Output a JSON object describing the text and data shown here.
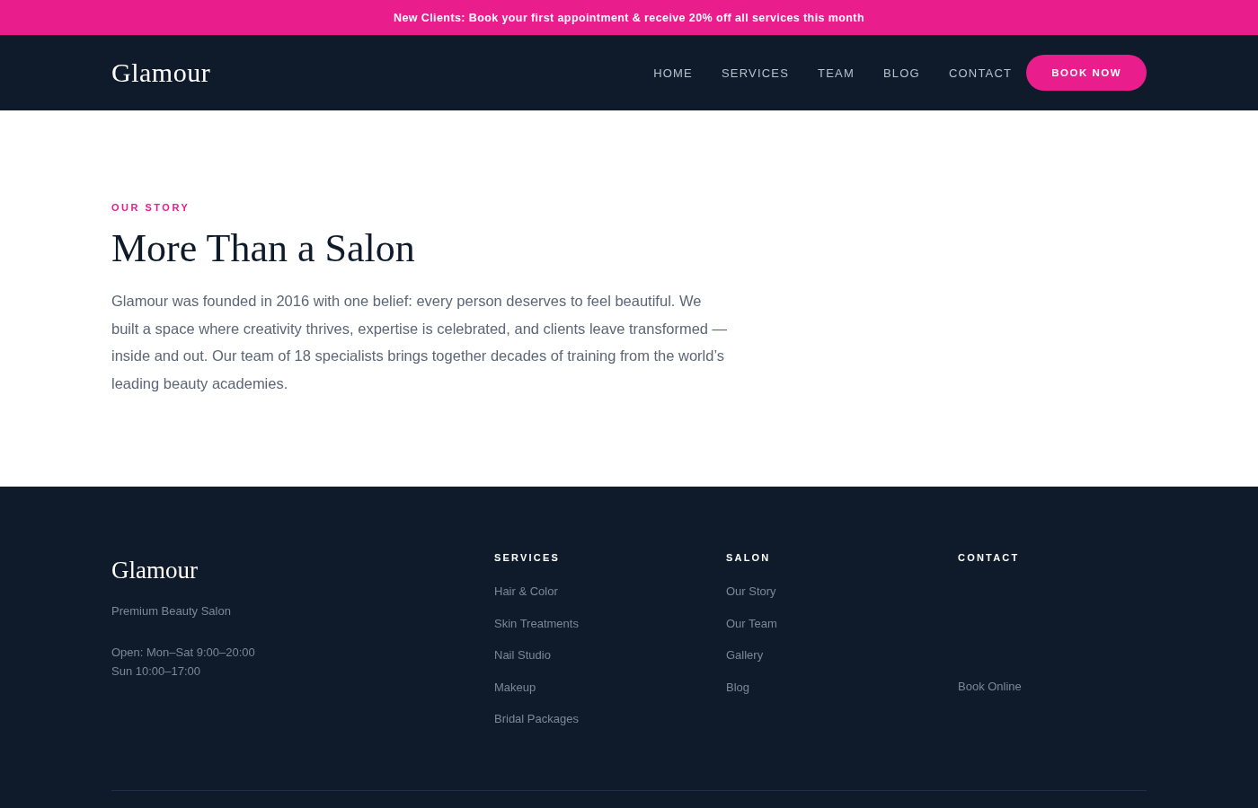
{
  "announcement": "**New Clients:** Book your first appointment & receive 20% off all services this month",
  "header": {
    "logo": "Glamour",
    "nav": [
      {
        "label": "HOME"
      },
      {
        "label": "SERVICES"
      },
      {
        "label": "TEAM"
      },
      {
        "label": "BLOG"
      },
      {
        "label": "CONTACT"
      }
    ],
    "cta": "BOOK NOW"
  },
  "story": {
    "eyebrow": "OUR STORY",
    "heading": "More Than a Salon",
    "body": "Glamour was founded in 2016 with one belief: every person deserves to feel beautiful. We built a space where creativity thrives, expertise is celebrated, and clients leave transformed — inside and out. Our team of 18 specialists brings together decades of training from the world’s leading beauty academies."
  },
  "footer": {
    "logo": "Glamour",
    "tagline": "Premium Beauty Salon",
    "hours": [
      "Open: Mon–Sat 9:00–20:00",
      "Sun 10:00–17:00"
    ],
    "columns": [
      {
        "kind": "links",
        "title": "SERVICES",
        "links": [
          "Hair & Color",
          "Skin Treatments",
          "Nail Studio",
          "Makeup",
          "Bridal Packages"
        ]
      },
      {
        "kind": "links",
        "title": "SALON",
        "links": [
          "Our Story",
          "Our Team",
          "Gallery",
          "Blog"
        ]
      },
      {
        "kind": "contact",
        "title": "CONTACT",
        "links": [
          "Book Online"
        ]
      }
    ]
  }
}
